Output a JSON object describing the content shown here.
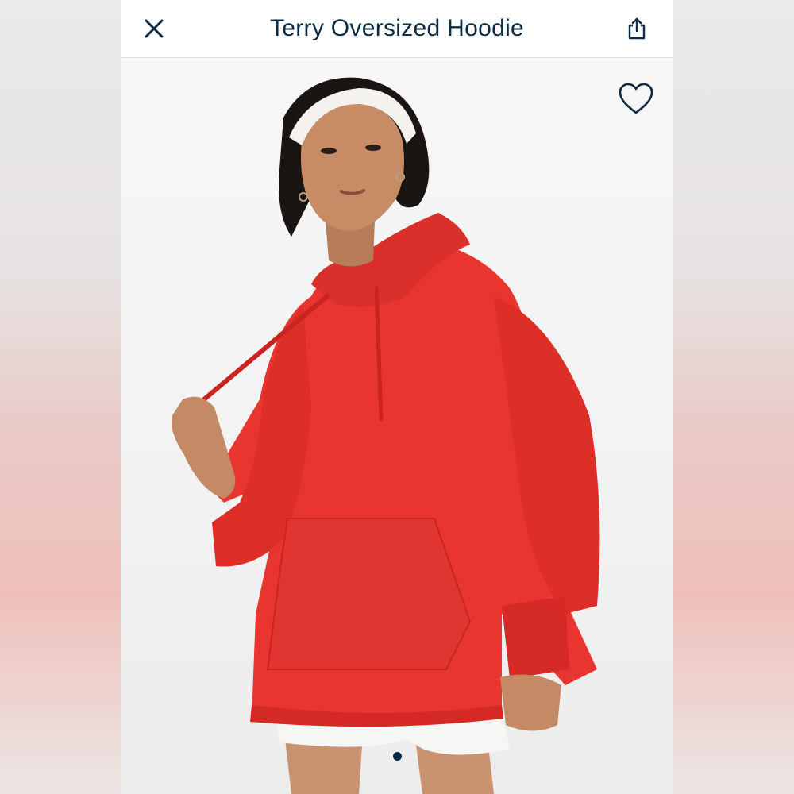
{
  "header": {
    "title": "Terry Oversized Hoodie",
    "close_icon": "close-icon",
    "share_icon": "share-icon"
  },
  "product_image": {
    "favorite_icon": "heart-outline-icon",
    "garment_color": "#e8352f",
    "carousel_page_count": 1,
    "carousel_active_index": 0
  },
  "colors": {
    "text_primary": "#0b2a44",
    "accent": "#0b2a44"
  }
}
